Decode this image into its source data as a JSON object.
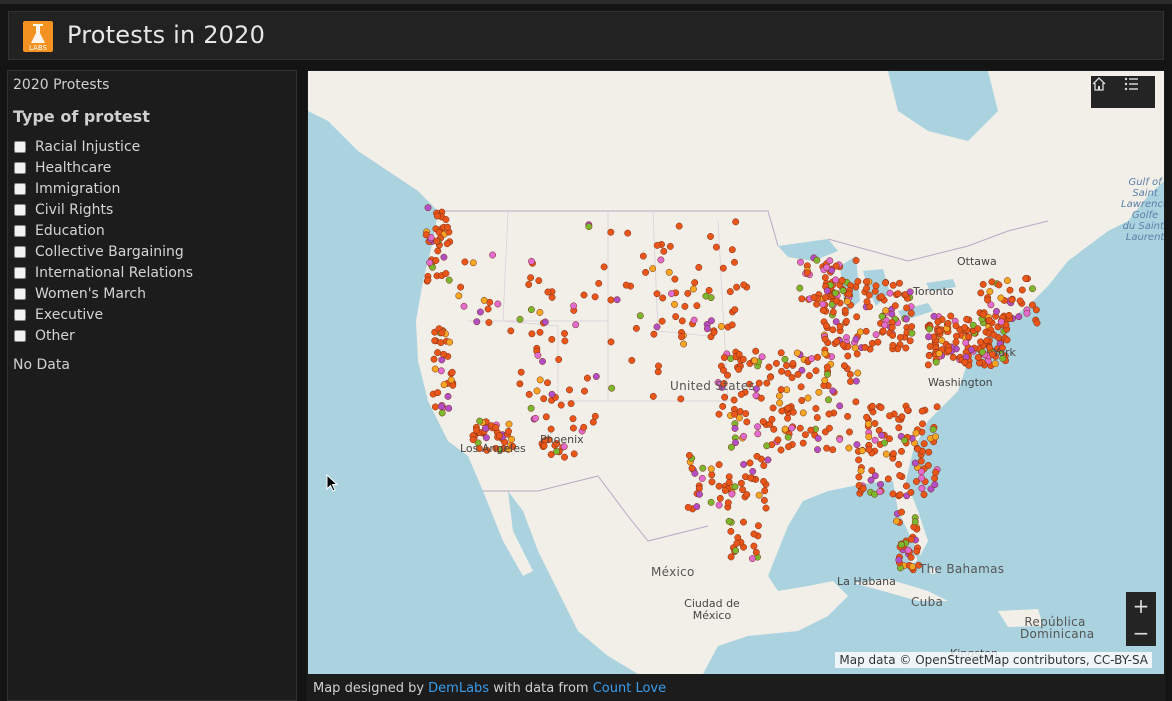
{
  "app": {
    "title": "Protests in 2020",
    "logo_text": "LABS"
  },
  "sidebar": {
    "panel_title": "2020 Protests",
    "filter_heading": "Type of protest",
    "filters": [
      {
        "label": "Racial Injustice",
        "checked": false
      },
      {
        "label": "Healthcare",
        "checked": false
      },
      {
        "label": "Immigration",
        "checked": false
      },
      {
        "label": "Civil Rights",
        "checked": false
      },
      {
        "label": "Education",
        "checked": false
      },
      {
        "label": "Collective Bargaining",
        "checked": false
      },
      {
        "label": "International Relations",
        "checked": false
      },
      {
        "label": "Women's March",
        "checked": false
      },
      {
        "label": "Executive",
        "checked": false
      },
      {
        "label": "Other",
        "checked": false
      }
    ],
    "status_text": "No Data"
  },
  "map": {
    "labels": {
      "gulf_st_lawrence": "Gulf of Saint Lawrence Golfe du Saint-Laurent",
      "ottawa": "Ottawa",
      "toronto": "Toronto",
      "new_york": "York",
      "washington": "Washington",
      "united_states": "United States",
      "phoenix": "Phoenix",
      "los_angeles": "Los Angeles",
      "mexico": "México",
      "mexico_city": "Ciudad de México",
      "la_habana": "La Habana",
      "bahamas": "The Bahamas",
      "cuba": "Cuba",
      "dominican_republic": "República Dominicana",
      "kingston": "Kingston"
    },
    "attribution": "Map data © OpenStreetMap contributors, CC-BY-SA",
    "point_colors": {
      "racial_injustice": "#e8561a",
      "civil_rights": "#f5a623",
      "other": "#b34fc6",
      "womens_march": "#e26bd0",
      "healthcare": "#7cb82f"
    }
  },
  "widgets": {
    "home_icon": "home-icon",
    "legend_icon": "list-icon",
    "zoom_in_label": "+",
    "zoom_out_label": "−"
  },
  "footer": {
    "prefix": "Map designed by ",
    "link1": "DemLabs",
    "middle": " with data from ",
    "link2": "Count Love"
  }
}
